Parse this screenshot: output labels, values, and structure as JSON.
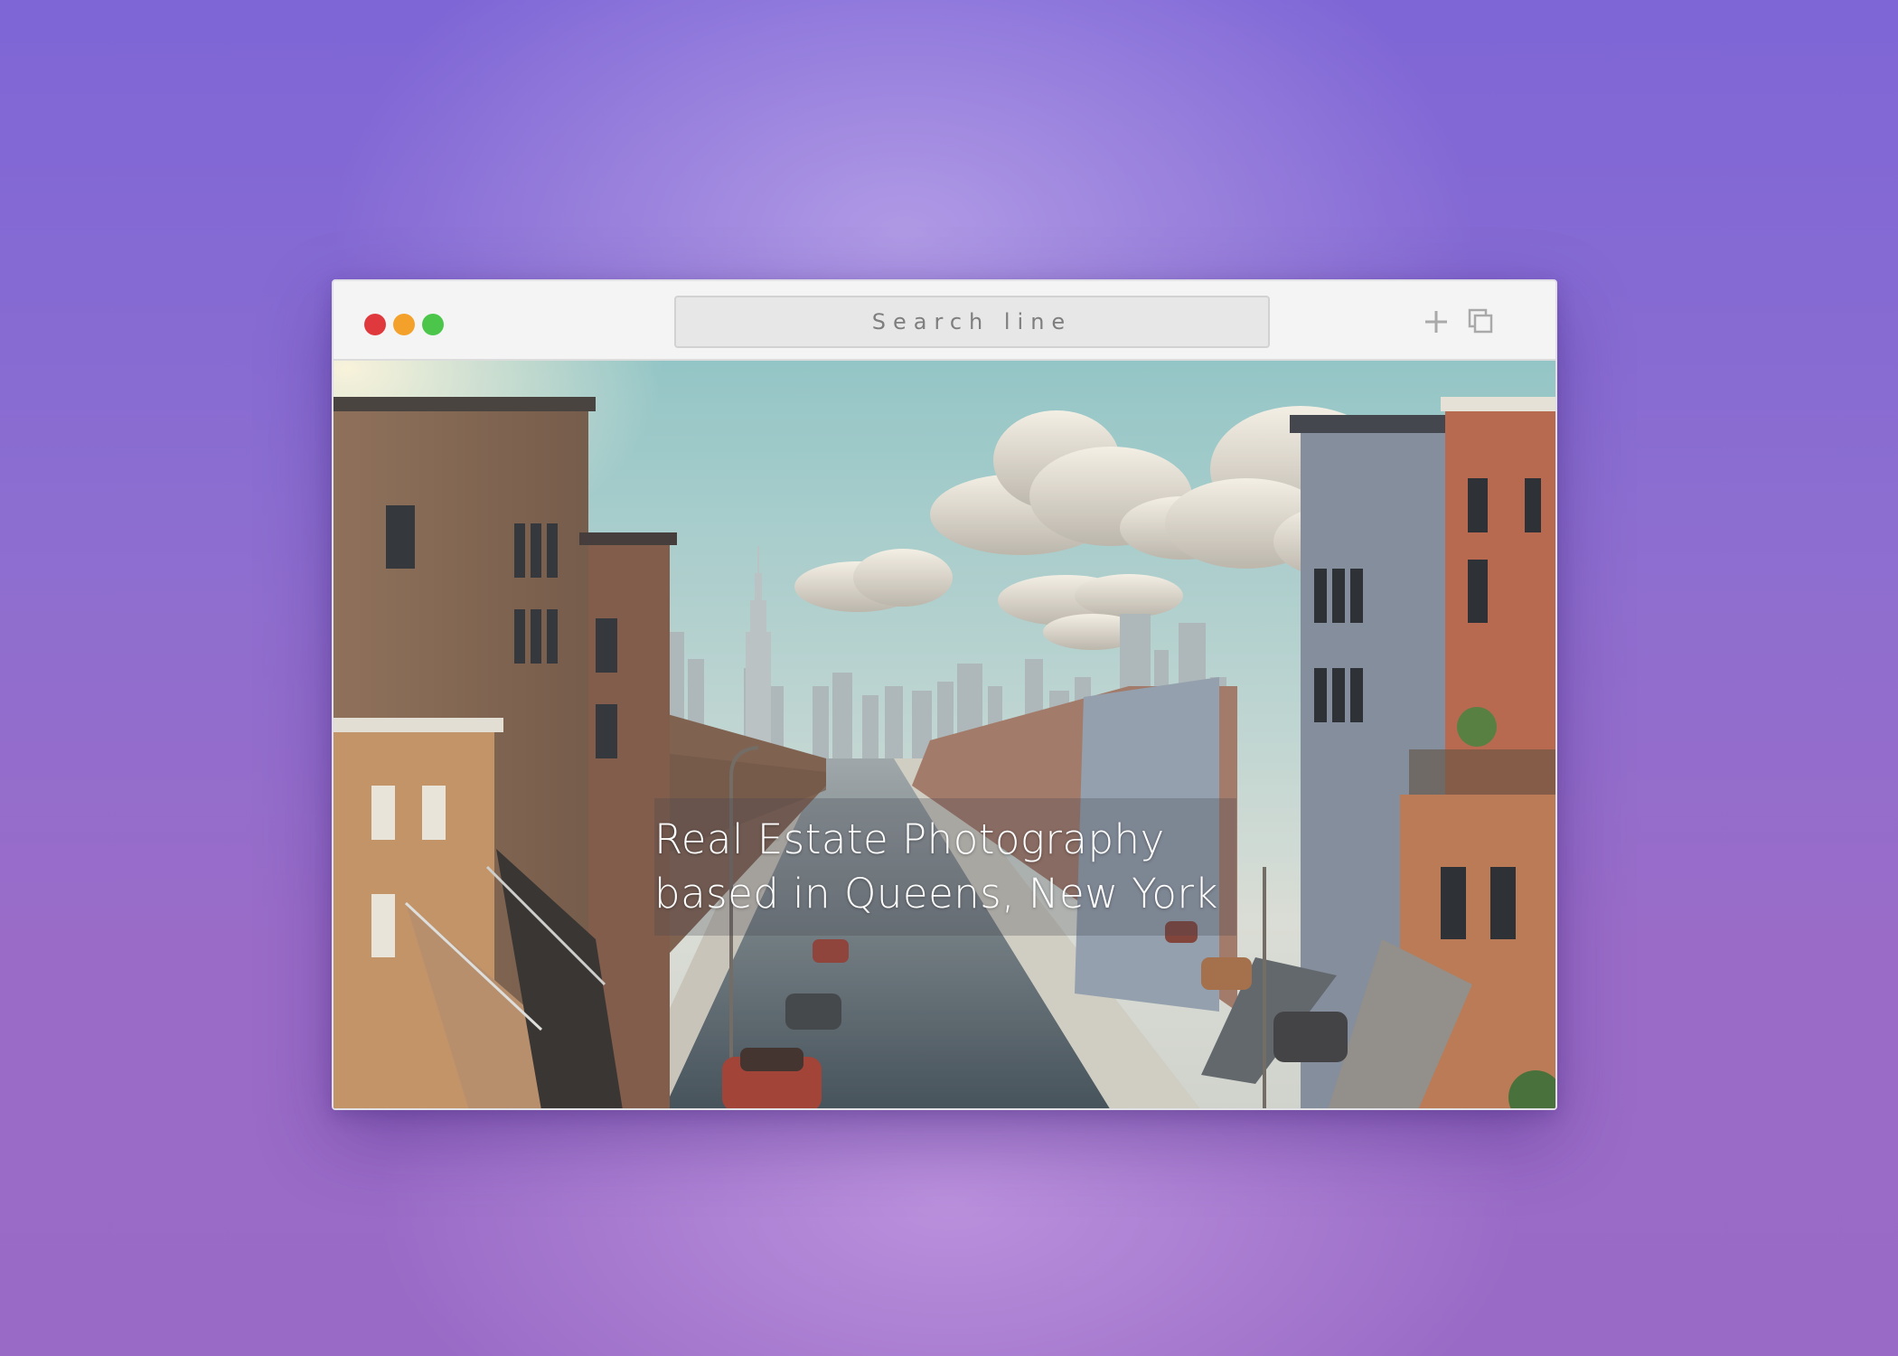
{
  "window": {
    "traffic_lights": [
      {
        "name": "close",
        "color": "#e0393d"
      },
      {
        "name": "minimize",
        "color": "#f3a12a"
      },
      {
        "name": "maximize",
        "color": "#4bc64b"
      }
    ],
    "search": {
      "placeholder": "Search line"
    },
    "toolbar_icons": [
      "plus-icon",
      "tabs-icon"
    ]
  },
  "hero": {
    "headline_line1": "Real Estate Photography",
    "headline_line2": "based in Queens, New York",
    "image": "street-of-brownstones-with-manhattan-skyline"
  },
  "colors": {
    "background_top": "#7e66d6",
    "background_bottom": "#9a6bc6",
    "chrome": "#f4f4f4",
    "search_text": "#7e7e7e",
    "headline_text": "#ffffff"
  }
}
